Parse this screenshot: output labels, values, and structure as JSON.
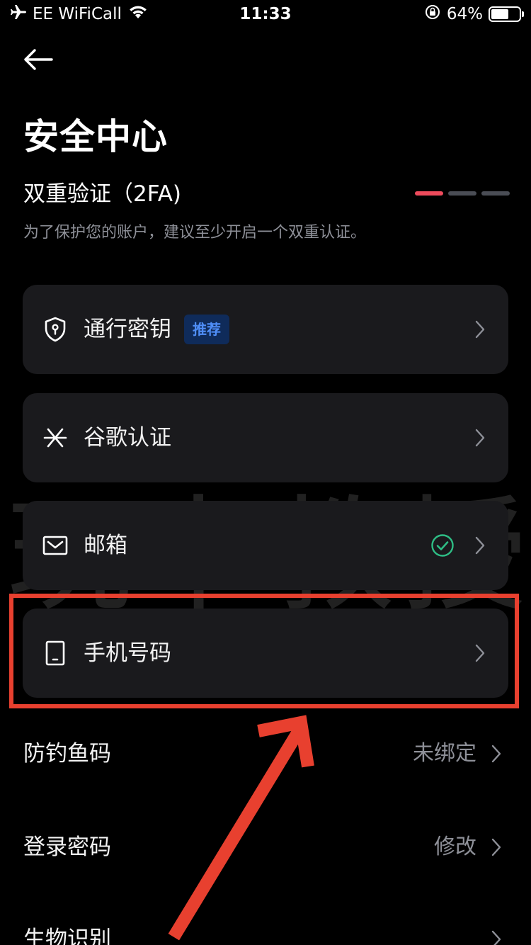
{
  "status_bar": {
    "carrier": "EE WiFiCall",
    "time": "11:33",
    "battery_percent": "64%",
    "battery_level": 0.64,
    "icons": [
      "airplane-icon",
      "wifi-icon",
      "rotation-lock-icon",
      "battery-icon"
    ]
  },
  "header": {
    "back_icon": "back-arrow-icon",
    "title": "安全中心"
  },
  "two_factor": {
    "title": "双重验证（2FA)",
    "description": "为了保护您的账户，建议至少开启一个双重认证。",
    "progress_steps": 3,
    "progress_active": 1,
    "colors": {
      "active": "#ee4b5c",
      "inactive": "#4a4d55"
    }
  },
  "cards": [
    {
      "label": "通行密钥",
      "icon": "shield-icon",
      "badge": "推荐"
    },
    {
      "label": "谷歌认证",
      "icon": "authenticator-icon"
    },
    {
      "label": "邮箱",
      "icon": "mail-icon",
      "status_icon": "check-circle-icon",
      "enabled": true
    },
    {
      "label": "手机号码",
      "icon": "phone-icon"
    }
  ],
  "rows": [
    {
      "label": "防钓鱼码",
      "value": "未绑定"
    },
    {
      "label": "登录密码",
      "value": "修改"
    },
    {
      "label": "生物识别",
      "value": ""
    }
  ],
  "watermark": "玩卡教授",
  "annotation": {
    "color": "#e8402f"
  }
}
